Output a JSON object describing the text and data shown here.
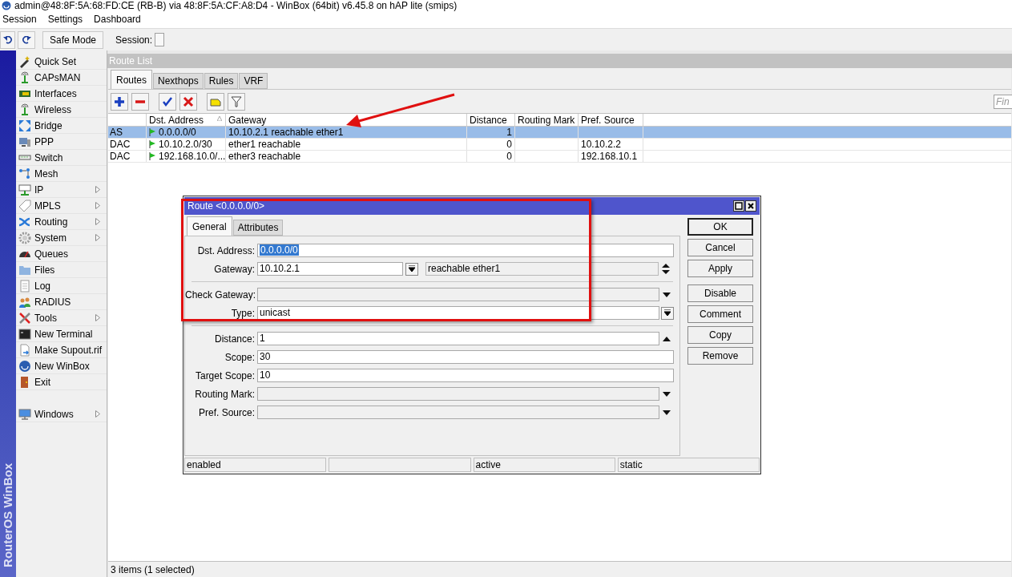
{
  "window": {
    "title": "admin@48:8F:5A:68:FD:CE (RB-B) via 48:8F:5A:CF:A8:D4 - WinBox (64bit) v6.45.8 on hAP lite (smips)"
  },
  "menu": [
    "Session",
    "Settings",
    "Dashboard"
  ],
  "toolbar": {
    "safe_mode": "Safe Mode",
    "session_label": "Session:"
  },
  "side_banner": "RouterOS WinBox",
  "sidebar": {
    "items": [
      {
        "label": "Quick Set",
        "submenu": false
      },
      {
        "label": "CAPsMAN",
        "submenu": false
      },
      {
        "label": "Interfaces",
        "submenu": false
      },
      {
        "label": "Wireless",
        "submenu": false
      },
      {
        "label": "Bridge",
        "submenu": false
      },
      {
        "label": "PPP",
        "submenu": false
      },
      {
        "label": "Switch",
        "submenu": false
      },
      {
        "label": "Mesh",
        "submenu": false
      },
      {
        "label": "IP",
        "submenu": true
      },
      {
        "label": "MPLS",
        "submenu": true
      },
      {
        "label": "Routing",
        "submenu": true
      },
      {
        "label": "System",
        "submenu": true
      },
      {
        "label": "Queues",
        "submenu": false
      },
      {
        "label": "Files",
        "submenu": false
      },
      {
        "label": "Log",
        "submenu": false
      },
      {
        "label": "RADIUS",
        "submenu": false
      },
      {
        "label": "Tools",
        "submenu": true
      },
      {
        "label": "New Terminal",
        "submenu": false
      },
      {
        "label": "Make Supout.rif",
        "submenu": false
      },
      {
        "label": "New WinBox",
        "submenu": false
      },
      {
        "label": "Exit",
        "submenu": false
      }
    ],
    "bottom_items": [
      {
        "label": "Windows",
        "submenu": true
      }
    ]
  },
  "route_list": {
    "title": "Route List",
    "tabs": [
      {
        "label": "Routes",
        "selected": true
      },
      {
        "label": "Nexthops",
        "selected": false
      },
      {
        "label": "Rules",
        "selected": false
      },
      {
        "label": "VRF",
        "selected": false
      }
    ],
    "find_placeholder": "Fin",
    "table": {
      "columns": [
        {
          "label": "Dst. Address",
          "sorted": true
        },
        {
          "label": "Gateway",
          "sorted": false
        },
        {
          "label": "Distance",
          "sorted": false
        },
        {
          "label": "Routing Mark",
          "sorted": false
        },
        {
          "label": "Pref. Source",
          "sorted": false
        }
      ],
      "rows": [
        {
          "flags": "AS",
          "dst_address": "0.0.0.0/0",
          "gateway": "10.10.2.1 reachable ether1",
          "distance": "1",
          "selected": true
        },
        {
          "flags": "DAC",
          "dst_address": "10.10.2.0/30",
          "gateway": "ether1 reachable",
          "distance": "0",
          "pref_source": "10.10.2.2",
          "selected": false
        },
        {
          "flags": "DAC",
          "dst_address": "192.168.10.0/...",
          "gateway": "ether3 reachable",
          "distance": "0",
          "pref_source": "192.168.10.1",
          "selected": false
        }
      ]
    },
    "status": "3 items (1 selected)"
  },
  "dialog": {
    "title": "Route <0.0.0.0/0>",
    "tabs": [
      {
        "label": "General",
        "selected": true
      },
      {
        "label": "Attributes",
        "selected": false
      }
    ],
    "sections": [
      [
        {
          "kind": "text",
          "label": "Dst. Address:",
          "value": "0.0.0.0/0",
          "highlighted": true,
          "disabled": false
        },
        {
          "kind": "gateway",
          "label": "Gateway:",
          "value": "10.10.2.1",
          "status": "reachable ether1",
          "highlighted": false,
          "disabled": false
        }
      ],
      [
        {
          "kind": "dropdown",
          "label": "Check Gateway:",
          "highlighted": false,
          "disabled": true
        },
        {
          "kind": "combo",
          "label": "Type:",
          "value": "unicast",
          "highlighted": false,
          "disabled": false
        }
      ],
      [
        {
          "kind": "spinner",
          "label": "Distance:",
          "value": "1",
          "highlighted": false,
          "disabled": false
        },
        {
          "kind": "text",
          "label": "Scope:",
          "value": "30",
          "highlighted": false,
          "disabled": false
        },
        {
          "kind": "text",
          "label": "Target Scope:",
          "value": "10",
          "highlighted": false,
          "disabled": false
        },
        {
          "kind": "dropdown",
          "label": "Routing Mark:",
          "highlighted": false,
          "disabled": true
        },
        {
          "kind": "dropdown",
          "label": "Pref. Source:",
          "highlighted": false,
          "disabled": true
        }
      ]
    ],
    "buttons": [
      [
        {
          "label": "OK",
          "default": true
        },
        {
          "label": "Cancel",
          "default": false
        },
        {
          "label": "Apply",
          "default": false
        }
      ],
      [
        {
          "label": "Disable",
          "default": false
        },
        {
          "label": "Comment",
          "default": false
        },
        {
          "label": "Copy",
          "default": false
        },
        {
          "label": "Remove",
          "default": false
        }
      ]
    ],
    "status_cells": [
      {
        "text": "enabled"
      },
      {},
      {
        "text": "active"
      },
      {
        "text": "static"
      }
    ]
  }
}
